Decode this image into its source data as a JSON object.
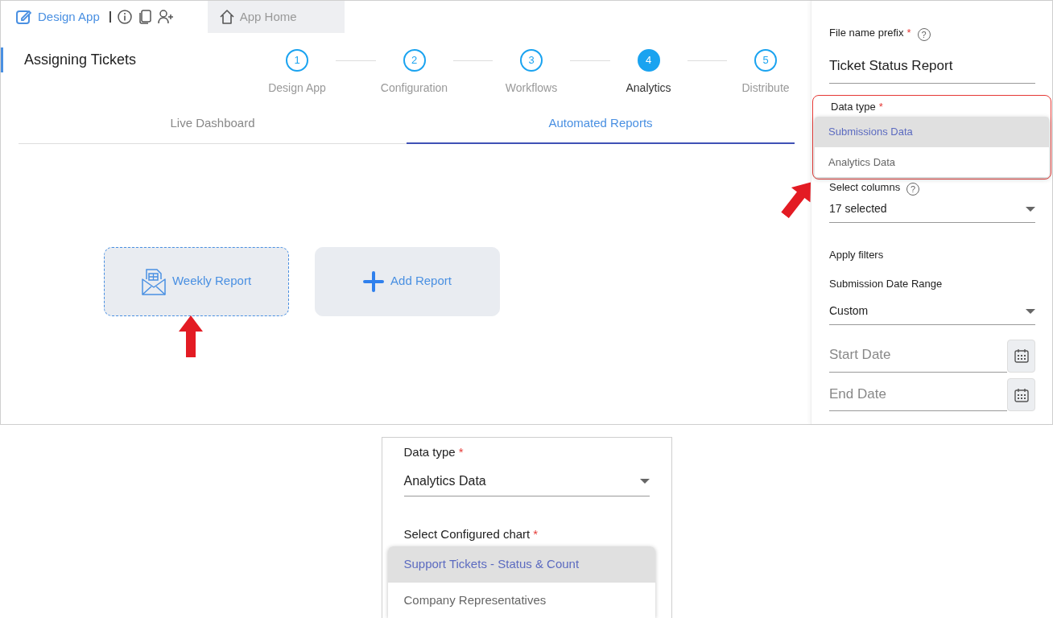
{
  "app_bar": {
    "title": "Design App",
    "home_tab": {
      "label": "App Home"
    }
  },
  "page_title": "Assigning Tickets",
  "steps": [
    {
      "number": "1",
      "label": "Design App",
      "selected": false
    },
    {
      "number": "2",
      "label": "Configuration",
      "selected": false
    },
    {
      "number": "3",
      "label": "Workflows",
      "selected": false
    },
    {
      "number": "4",
      "label": "Analytics",
      "selected": true
    },
    {
      "number": "5",
      "label": "Distribute",
      "selected": false
    }
  ],
  "view_tabs": [
    {
      "label": "Live Dashboard",
      "selected": false
    },
    {
      "label": "Automated Reports",
      "selected": true
    }
  ],
  "reports": [
    {
      "kind": "report",
      "label": "Weekly Report",
      "selected": true
    },
    {
      "kind": "add",
      "label": "Add Report",
      "selected": false
    }
  ],
  "settings_panel": {
    "file_prefix": {
      "label": "File name prefix",
      "required_mark": "*",
      "help": "?",
      "value": "Ticket Status Report"
    },
    "data_type": {
      "label": "Data type",
      "required_mark": "*",
      "options": [
        {
          "label": "Submissions Data",
          "selected": true
        },
        {
          "label": "Analytics Data",
          "selected": false
        }
      ]
    },
    "select_columns": {
      "label": "Select columns",
      "help": "?",
      "value": "17 selected"
    },
    "filters_heading": "Apply filters",
    "date_range": {
      "label": "Submission Date Range",
      "value": "Custom"
    },
    "start_date": {
      "placeholder": "Start Date"
    },
    "end_date": {
      "placeholder": "End Date"
    }
  },
  "inset": {
    "data_type": {
      "label": "Data type",
      "required_mark": "*",
      "value": "Analytics Data"
    },
    "chart_select": {
      "label": "Select Configured chart",
      "required_mark": "*",
      "options": [
        {
          "label": "Support Tickets - Status & Count",
          "selected": true
        },
        {
          "label": "Company Representatives",
          "selected": false
        }
      ]
    }
  }
}
